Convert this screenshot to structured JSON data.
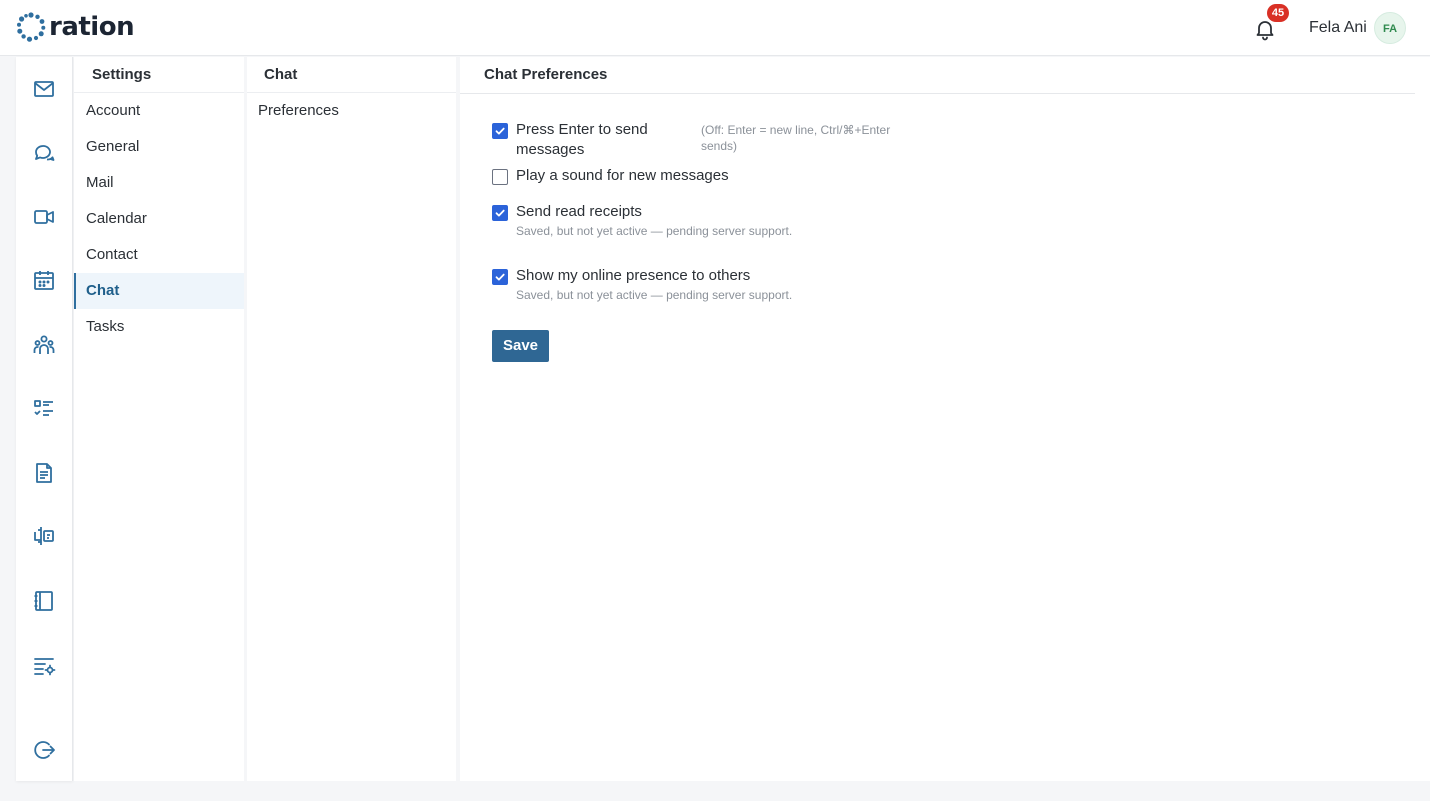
{
  "app": {
    "logo_text": "ration",
    "notifications_count": "45",
    "user_name": "Fela Ani",
    "user_initials": "FA"
  },
  "rail": {
    "icons": [
      "mail-icon",
      "chat-icon",
      "video-icon",
      "calendar-icon",
      "contacts-icon",
      "tasks-icon",
      "document-icon",
      "board-icon",
      "notebook-icon",
      "settings-list-icon",
      "logout-icon"
    ]
  },
  "settings_nav": {
    "title": "Settings",
    "items": [
      {
        "label": "Account"
      },
      {
        "label": "General"
      },
      {
        "label": "Mail"
      },
      {
        "label": "Calendar"
      },
      {
        "label": "Contact"
      },
      {
        "label": "Chat",
        "active": true
      },
      {
        "label": "Tasks"
      }
    ]
  },
  "chat_nav": {
    "title": "Chat",
    "items": [
      {
        "label": "Preferences"
      }
    ]
  },
  "main": {
    "title": "Chat Preferences",
    "preferences": [
      {
        "label_line1": "Press Enter to send",
        "label_line2": "messages",
        "checked": true,
        "hint": "(Off: Enter = new line, Ctrl/⌘+Enter sends)"
      },
      {
        "label": "Play a sound for new messages",
        "checked": false
      },
      {
        "label": "Send read receipts",
        "checked": true,
        "note": "Saved, but not yet active — pending server support."
      },
      {
        "label": "Show my online presence to others",
        "checked": true,
        "note": "Saved, but not yet active — pending server support."
      }
    ],
    "save_label": "Save"
  },
  "colors": {
    "accent": "#2f6794",
    "checkbox": "#2b63d9",
    "badge": "#d93025",
    "icon": "#2f6f9f"
  }
}
